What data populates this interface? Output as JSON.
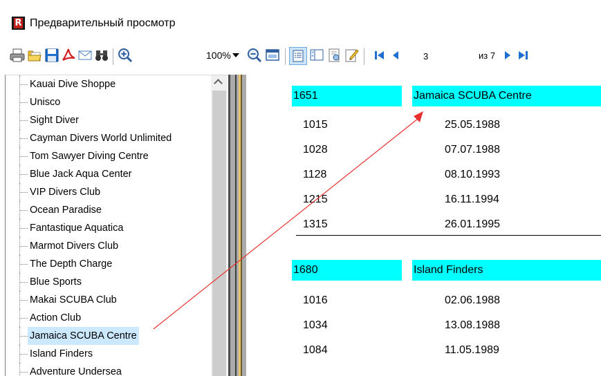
{
  "window": {
    "title": "Предварительный просмотр",
    "logo_letter": "R"
  },
  "toolbar": {
    "buttons": [
      {
        "name": "print-button",
        "icon": "printer-icon"
      },
      {
        "name": "open-button",
        "icon": "folder-open-icon"
      },
      {
        "name": "save-button",
        "icon": "floppy-disk-icon"
      },
      {
        "name": "export-pdf-button",
        "icon": "pdf-icon"
      },
      {
        "name": "send-email-button",
        "icon": "envelope-icon"
      },
      {
        "name": "find-button",
        "icon": "binoculars-icon"
      },
      {
        "name": "zoom-in-button",
        "icon": "zoom-in-icon"
      },
      {
        "name": "zoom-out-button",
        "icon": "zoom-out-icon"
      },
      {
        "name": "full-screen-button",
        "icon": "window-icon"
      },
      {
        "name": "outline-button",
        "icon": "outline-icon"
      },
      {
        "name": "thumbnails-button",
        "icon": "thumbnails-icon"
      },
      {
        "name": "page-setup-button",
        "icon": "page-setup-icon"
      },
      {
        "name": "edit-page-button",
        "icon": "edit-icon"
      },
      {
        "name": "first-page-button",
        "icon": "first-page-icon"
      },
      {
        "name": "prev-page-button",
        "icon": "prev-page-icon"
      },
      {
        "name": "next-page-button",
        "icon": "next-page-icon"
      },
      {
        "name": "last-page-button",
        "icon": "last-page-icon"
      }
    ],
    "zoom_value": "100%",
    "current_page": "3",
    "page_of": "из 7",
    "accent_colors": {
      "blue": "#1f6fd1",
      "pdf_red": "#d21f1f",
      "folder_yellow": "#f2c232"
    }
  },
  "tree": {
    "items": [
      "Kauai Dive Shoppe",
      "Unisco",
      "Sight Diver",
      "Cayman Divers World Unlimited",
      "Tom Sawyer Diving Centre",
      "Blue Jack Aqua Center",
      "VIP Divers Club",
      "Ocean Paradise",
      "Fantastique Aquatica",
      "Marmot Divers Club",
      "The Depth Charge",
      "Blue Sports",
      "Makai SCUBA Club",
      "Action Club",
      "Jamaica SCUBA Centre",
      "Island Finders",
      "Adventure Undersea"
    ],
    "selected": "Jamaica SCUBA Centre",
    "selected_color": "#cce8ff"
  },
  "report": {
    "groups": [
      {
        "id": "1651",
        "name": "Jamaica SCUBA Centre",
        "rows": [
          {
            "order": "1015",
            "date": "25.05.1988"
          },
          {
            "order": "1028",
            "date": "07.07.1988"
          },
          {
            "order": "1128",
            "date": "08.10.1993"
          },
          {
            "order": "1215",
            "date": "16.11.1994"
          },
          {
            "order": "1315",
            "date": "26.01.1995"
          }
        ]
      },
      {
        "id": "1680",
        "name": "Island Finders",
        "rows": [
          {
            "order": "1016",
            "date": "02.06.1988"
          },
          {
            "order": "1034",
            "date": "13.08.1988"
          },
          {
            "order": "1084",
            "date": "11.05.1989"
          }
        ]
      }
    ],
    "header_color": "#00ffff"
  },
  "annotation": {
    "color": "#e8302f",
    "meaning": "arrow from selected tree item to its report group header"
  }
}
